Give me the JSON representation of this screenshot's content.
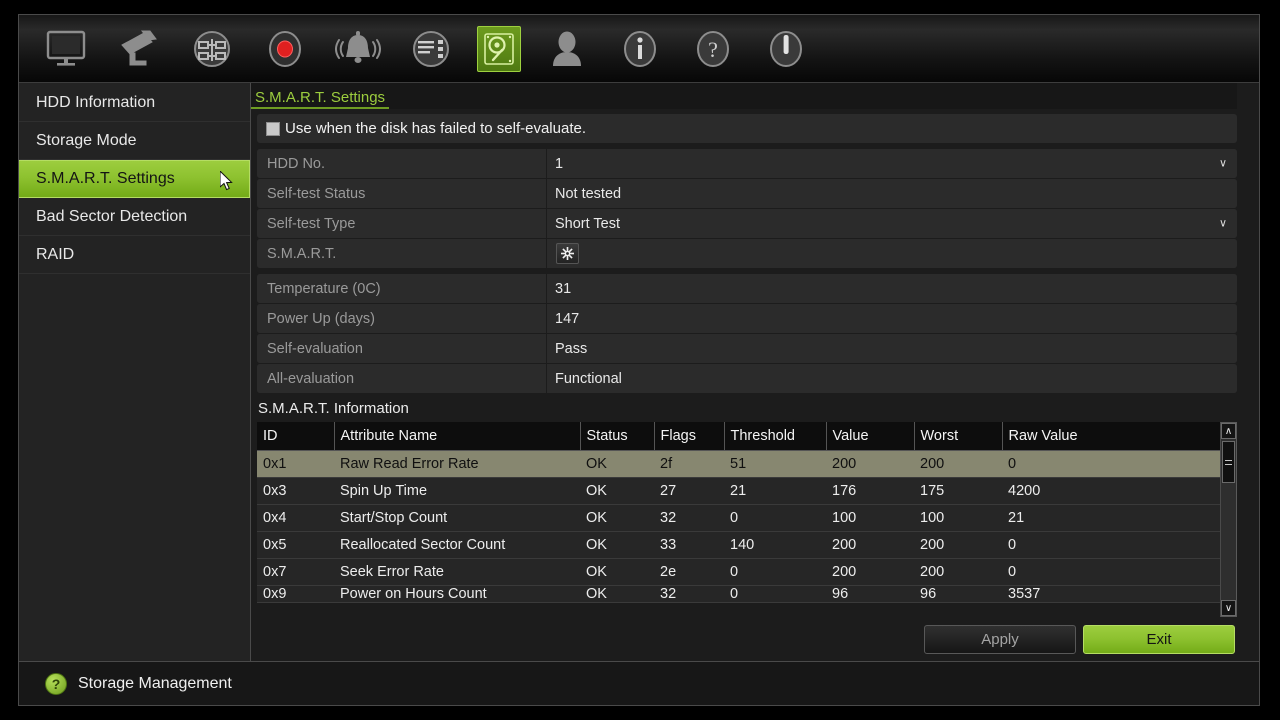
{
  "window": {
    "title": "S.M.A.R.T. Settings"
  },
  "toolbar": {
    "icons": [
      {
        "name": "display-icon",
        "label": "Display",
        "active": false
      },
      {
        "name": "camera-icon",
        "label": "Camera",
        "active": false
      },
      {
        "name": "network-icon",
        "label": "Network",
        "active": false
      },
      {
        "name": "record-icon",
        "label": "Record",
        "active": false
      },
      {
        "name": "alarm-bell-icon",
        "label": "Alarm",
        "active": false
      },
      {
        "name": "device-config-icon",
        "label": "Configuration",
        "active": false
      },
      {
        "name": "hdd-icon",
        "label": "HDD",
        "active": true
      },
      {
        "name": "user-icon",
        "label": "User",
        "active": false
      },
      {
        "name": "info-icon",
        "label": "Information",
        "active": false
      },
      {
        "name": "help-icon",
        "label": "Help",
        "active": false
      },
      {
        "name": "power-icon",
        "label": "Shutdown",
        "active": false
      }
    ]
  },
  "sidebar": {
    "items": [
      {
        "label": "HDD Information",
        "selected": false
      },
      {
        "label": "Storage Mode",
        "selected": false
      },
      {
        "label": "S.M.A.R.T. Settings",
        "selected": true
      },
      {
        "label": "Bad Sector Detection",
        "selected": false
      },
      {
        "label": "RAID",
        "selected": false
      }
    ]
  },
  "tab": {
    "label": "S.M.A.R.T. Settings"
  },
  "checkbox": {
    "label": "Use when the disk has failed to self-evaluate.",
    "checked": false
  },
  "form": {
    "rows": [
      {
        "label": "HDD No.",
        "value": "1",
        "type": "dropdown"
      },
      {
        "label": "Self-test Status",
        "value": "Not tested",
        "type": "text"
      },
      {
        "label": "Self-test Type",
        "value": "Short Test",
        "type": "dropdown"
      },
      {
        "label": "S.M.A.R.T.",
        "value": "",
        "type": "button"
      },
      {
        "label": "Temperature (0C)",
        "value": "31",
        "type": "text"
      },
      {
        "label": "Power Up (days)",
        "value": "147",
        "type": "text"
      },
      {
        "label": "Self-evaluation",
        "value": "Pass",
        "type": "text"
      },
      {
        "label": "All-evaluation",
        "value": "Functional",
        "type": "text"
      }
    ]
  },
  "smart_info": {
    "title": "S.M.A.R.T. Information",
    "columns": [
      "ID",
      "Attribute Name",
      "Status",
      "Flags",
      "Threshold",
      "Value",
      "Worst",
      "Raw Value"
    ],
    "rows": [
      {
        "cells": [
          "0x1",
          "Raw Read Error Rate",
          "OK",
          "2f",
          "51",
          "200",
          "200",
          "0"
        ],
        "selected": true,
        "clipped": false
      },
      {
        "cells": [
          "0x3",
          "Spin Up Time",
          "OK",
          "27",
          "21",
          "176",
          "175",
          "4200"
        ],
        "selected": false,
        "clipped": false
      },
      {
        "cells": [
          "0x4",
          "Start/Stop Count",
          "OK",
          "32",
          "0",
          "100",
          "100",
          "21"
        ],
        "selected": false,
        "clipped": false
      },
      {
        "cells": [
          "0x5",
          "Reallocated Sector Count",
          "OK",
          "33",
          "140",
          "200",
          "200",
          "0"
        ],
        "selected": false,
        "clipped": false
      },
      {
        "cells": [
          "0x7",
          "Seek Error Rate",
          "OK",
          "2e",
          "0",
          "200",
          "200",
          "0"
        ],
        "selected": false,
        "clipped": false
      },
      {
        "cells": [
          "0x9",
          "Power on Hours Count",
          "OK",
          "32",
          "0",
          "96",
          "96",
          "3537"
        ],
        "selected": false,
        "clipped": true
      }
    ]
  },
  "scrollbar": {
    "up_glyph": "∧",
    "down_glyph": "∨"
  },
  "buttons": {
    "apply": "Apply",
    "exit": "Exit"
  },
  "status": {
    "icon": "?",
    "text": "Storage Management"
  },
  "colors": {
    "accent_green": "#9ccd3e",
    "selected_row": "#878770",
    "panel_bg": "#1c1c1c",
    "row_bg": "#2b2b2b"
  }
}
